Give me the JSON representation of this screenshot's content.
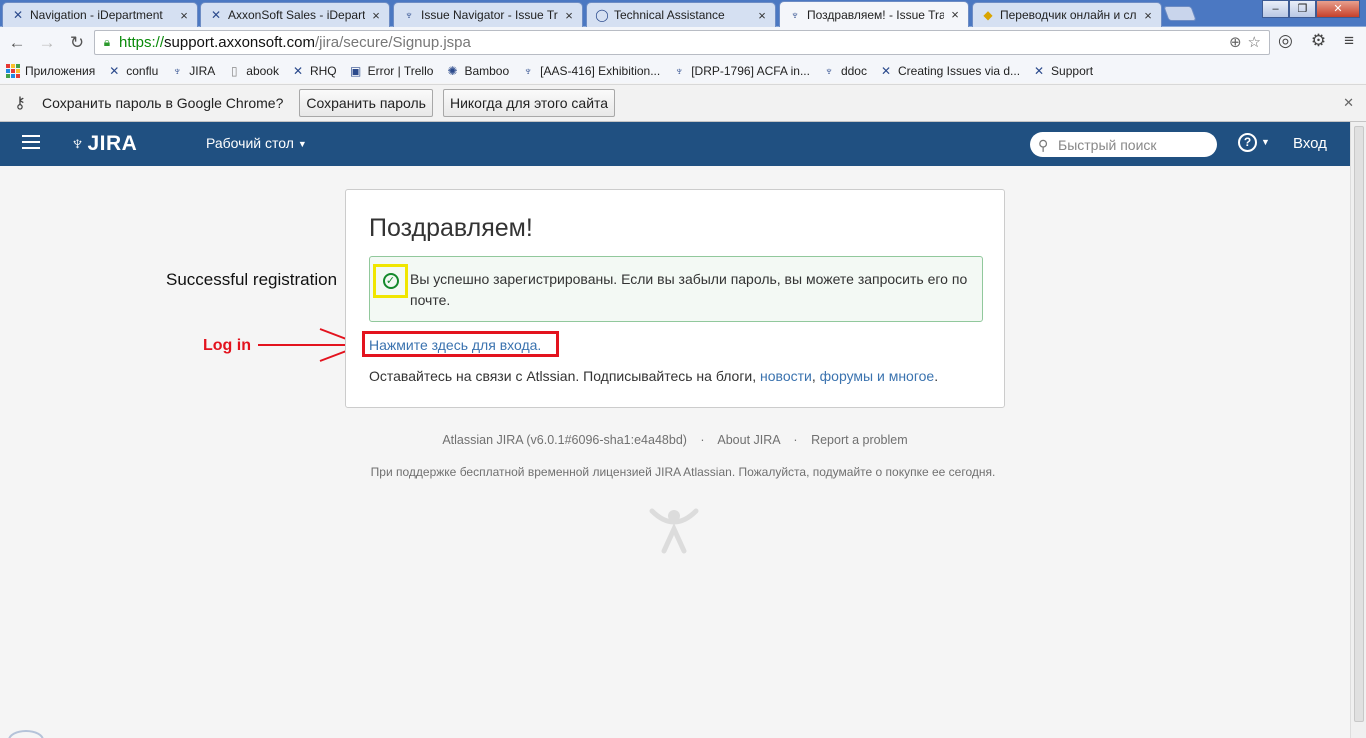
{
  "browser": {
    "tabs": [
      {
        "title": "Navigation - iDepartment",
        "icon": "jira-x-icon",
        "active": false
      },
      {
        "title": "AxxonSoft Sales - iDepartm",
        "icon": "jira-x-icon",
        "active": false
      },
      {
        "title": "Issue Navigator - Issue Tra",
        "icon": "jira-icon",
        "active": false
      },
      {
        "title": "Technical Assistance",
        "icon": "support-circle-icon",
        "active": false
      },
      {
        "title": "Поздравляем! - Issue Trac",
        "icon": "jira-icon",
        "active": true
      },
      {
        "title": "Переводчик онлайн и сл",
        "icon": "translate-icon",
        "active": false
      }
    ],
    "url": {
      "scheme": "https://",
      "host": "support.axxonsoft.com",
      "path": "/jira/secure/Signup.jspa"
    },
    "bookmarks": [
      {
        "label": "Приложения",
        "icon": "apps-grid-icon"
      },
      {
        "label": "conflu",
        "icon": "confluence-icon"
      },
      {
        "label": "JIRA",
        "icon": "jira-icon"
      },
      {
        "label": "abook",
        "icon": "page-icon"
      },
      {
        "label": "RHQ",
        "icon": "jira-x-icon"
      },
      {
        "label": "Error | Trello",
        "icon": "trello-icon"
      },
      {
        "label": "Bamboo",
        "icon": "bamboo-icon"
      },
      {
        "label": "[AAS-416] Exhibition...",
        "icon": "jira-icon"
      },
      {
        "label": "[DRP-1796] ACFA in...",
        "icon": "jira-icon"
      },
      {
        "label": "ddoc",
        "icon": "jira-icon"
      },
      {
        "label": "Creating Issues via d...",
        "icon": "jira-x-icon"
      },
      {
        "label": "Support",
        "icon": "jira-x-icon"
      }
    ],
    "password_bar": {
      "message": "Сохранить пароль в Google Chrome?",
      "save_button": "Сохранить пароль",
      "never_button": "Никогда для этого сайта"
    }
  },
  "jira": {
    "logo_text": "JIRA",
    "dashboard_menu": "Рабочий стол",
    "search_placeholder": "Быстрый поиск",
    "login_link": "Вход"
  },
  "main": {
    "heading": "Поздравляем!",
    "success_message": "Вы успешно зарегистрированы. Если вы забыли пароль, вы можете запросить его по почте.",
    "login_prompt": "Нажмите здесь для входа.",
    "stay_text": "Оставайтесь на связи с Atlssian. Подписывайтесь на блоги,",
    "stay_link_news": "новости",
    "stay_link_forums": "форумы и многое",
    "stay_end": "."
  },
  "annotations": {
    "registration_label": "Successful registration",
    "login_label": "Log in",
    "highlight_color": "#f0e600",
    "box_color": "#e3131e"
  },
  "footer": {
    "version": "Atlassian JIRA (v6.0.1#6096-sha1:e4a48bd)",
    "about": "About JIRA",
    "report": "Report a problem",
    "license_note": "При поддержке бесплатной временной лицензией JIRA Atlassian. Пожалуйста, подумайте о покупке ее сегодня."
  },
  "colors": {
    "header_bg": "#205081",
    "link": "#3b73af",
    "success_border": "#91c89c"
  }
}
